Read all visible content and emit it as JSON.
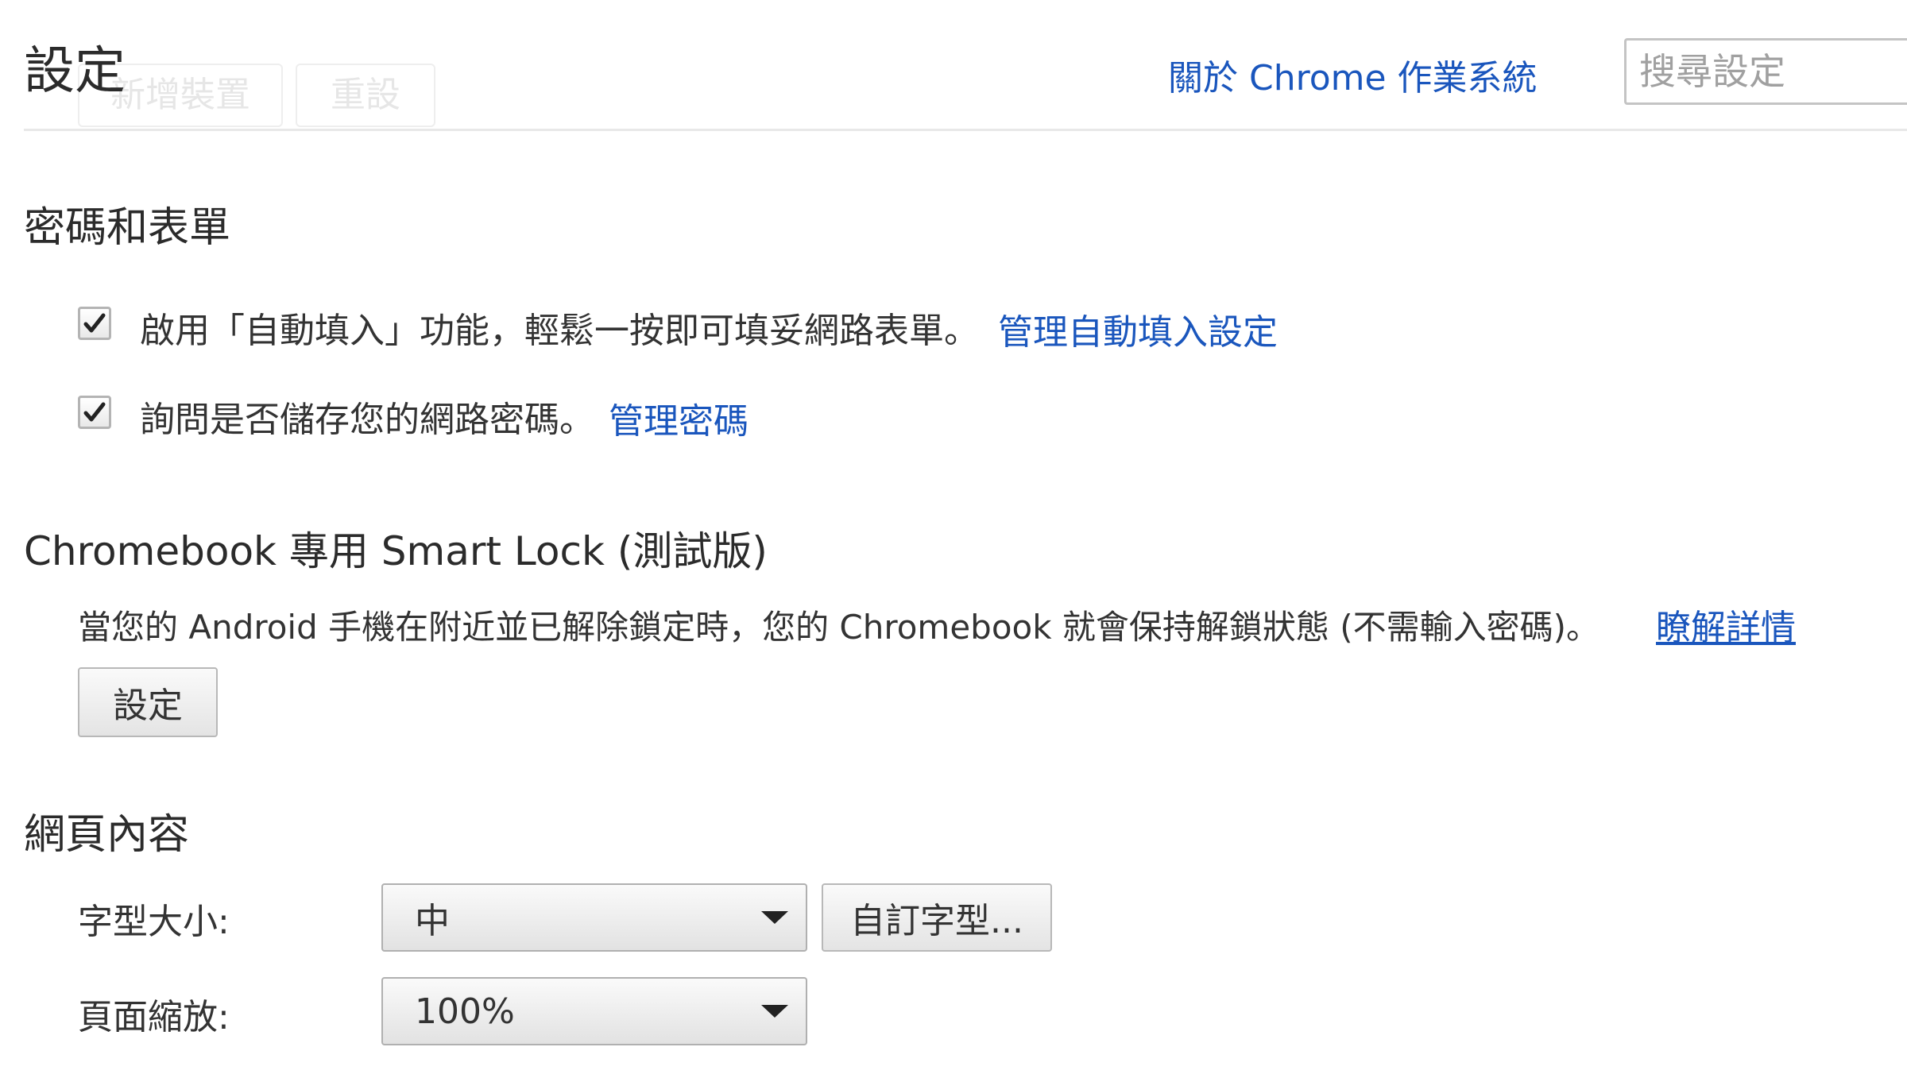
{
  "header": {
    "title": "設定",
    "about_link": "關於 Chrome 作業系統",
    "search_placeholder": "搜尋設定",
    "ghost_buttons": [
      "新增裝置",
      "重設"
    ]
  },
  "passwords_forms": {
    "title": "密碼和表單",
    "autofill": {
      "checked": true,
      "label": "啟用「自動填入」功能，輕鬆一按即可填妥網路表單。",
      "link": "管理自動填入設定"
    },
    "save_passwords": {
      "checked": true,
      "label": "詢問是否儲存您的網路密碼。",
      "link": "管理密碼"
    }
  },
  "smart_lock": {
    "title": "Chromebook 專用 Smart Lock (測試版)",
    "description": "當您的 Android 手機在附近並已解除鎖定時，您的 Chromebook 就會保持解鎖狀態 (不需輸入密碼)。",
    "learn_more": "瞭解詳情",
    "setup_button": "設定"
  },
  "web_content": {
    "title": "網頁內容",
    "font_size_label": "字型大小:",
    "font_size_value": "中",
    "customize_fonts_button": "自訂字型...",
    "page_zoom_label": "頁面縮放:",
    "page_zoom_value": "100%"
  },
  "colors": {
    "link": "#1a56bd",
    "text": "#333333"
  }
}
